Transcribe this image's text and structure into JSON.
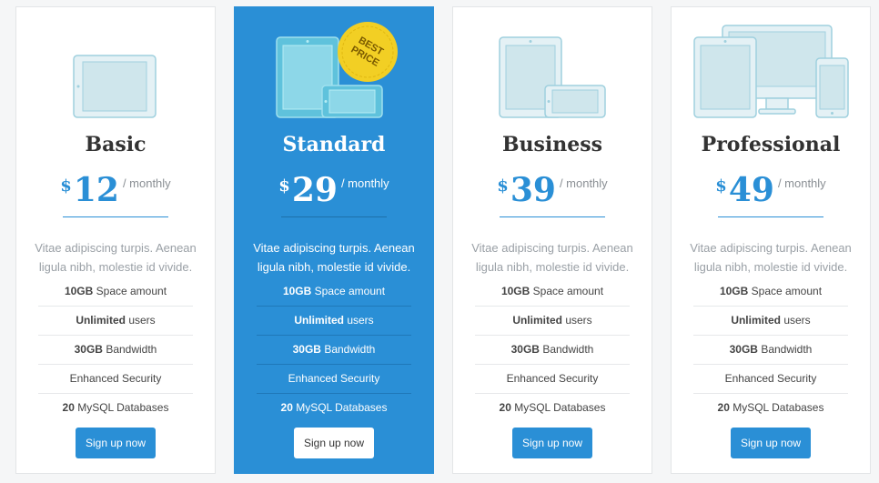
{
  "colors": {
    "accent": "#2a8fd6",
    "badge": "#f2cf24",
    "border": "#e3e5e7"
  },
  "plans": [
    {
      "name": "Basic",
      "currency": "$",
      "amount": "12",
      "period": "/ monthly",
      "description": "Vitae adipiscing turpis. Aenean ligula nibh, molestie id vivide.",
      "features": [
        {
          "bold": "10GB",
          "text": " Space amount"
        },
        {
          "bold": "Unlimited",
          "text": " users"
        },
        {
          "bold": "30GB",
          "text": " Bandwidth"
        },
        {
          "bold": "",
          "text": "Enhanced Security"
        },
        {
          "bold": "20",
          "text": " MySQL Databases"
        }
      ],
      "button": "Sign up now",
      "icon": "tablet-icon"
    },
    {
      "name": "Standard",
      "currency": "$",
      "amount": "29",
      "period": "/ monthly",
      "description": "Vitae adipiscing turpis. Aenean ligula nibh, molestie id vivide.",
      "features": [
        {
          "bold": "10GB",
          "text": " Space amount"
        },
        {
          "bold": "Unlimited",
          "text": " users"
        },
        {
          "bold": "30GB",
          "text": " Bandwidth"
        },
        {
          "bold": "",
          "text": "Enhanced Security"
        },
        {
          "bold": "20",
          "text": " MySQL Databases"
        }
      ],
      "button": "Sign up now",
      "icon": "tablet-and-phone-icon",
      "badge_line1": "BEST",
      "badge_line2": "PRICE"
    },
    {
      "name": "Business",
      "currency": "$",
      "amount": "39",
      "period": "/ monthly",
      "description": "Vitae adipiscing turpis. Aenean ligula nibh, molestie id vivide.",
      "features": [
        {
          "bold": "10GB",
          "text": " Space amount"
        },
        {
          "bold": "Unlimited",
          "text": " users"
        },
        {
          "bold": "30GB",
          "text": " Bandwidth"
        },
        {
          "bold": "",
          "text": "Enhanced Security"
        },
        {
          "bold": "20",
          "text": " MySQL Databases"
        }
      ],
      "button": "Sign up now",
      "icon": "tablet-and-phone-icon"
    },
    {
      "name": "Professional",
      "currency": "$",
      "amount": "49",
      "period": "/ monthly",
      "description": "Vitae adipiscing turpis. Aenean ligula nibh, molestie id vivide.",
      "features": [
        {
          "bold": "10GB",
          "text": " Space amount"
        },
        {
          "bold": "Unlimited",
          "text": " users"
        },
        {
          "bold": "30GB",
          "text": " Bandwidth"
        },
        {
          "bold": "",
          "text": "Enhanced Security"
        },
        {
          "bold": "20",
          "text": " MySQL Databases"
        }
      ],
      "button": "Sign up now",
      "icon": "all-devices-icon"
    }
  ]
}
